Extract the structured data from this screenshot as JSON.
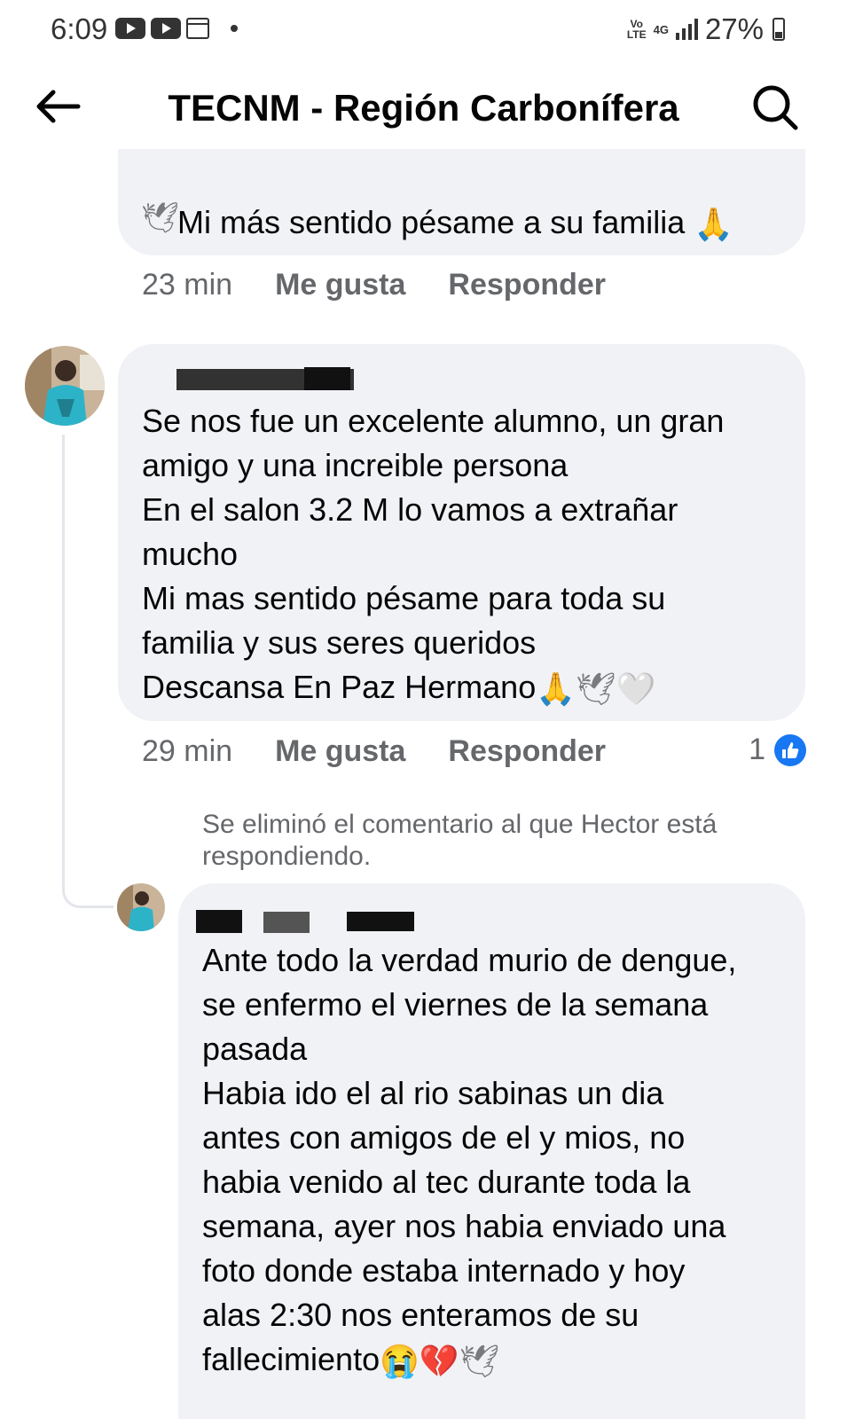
{
  "status_bar": {
    "time": "6:09",
    "network": "4G",
    "lte": "Vo LTE",
    "battery": "27%"
  },
  "header": {
    "title": "TECNM - Región Carbonífera"
  },
  "comment_top": {
    "text": "Mi más sentido pésame a su familia ",
    "time": "23 min",
    "like_label": "Me gusta",
    "reply_label": "Responder"
  },
  "comment_main": {
    "text": "Se nos fue un excelente alumno, un gran\namigo y una increible persona\nEn el salon 3.2 M lo vamos a extrañar\nmucho\nMi mas sentido pésame para toda su\nfamilia y sus seres queridos\nDescansa En Paz Hermano",
    "time": "29 min",
    "like_label": "Me gusta",
    "reply_label": "Responder",
    "likes": "1"
  },
  "deleted_notice": "Se eliminó el comentario al que Hector está respondiendo.",
  "reply": {
    "text": "Ante todo la verdad murio de dengue,\nse enfermo el viernes de la semana\npasada\nHabia ido el al rio sabinas un dia\nantes con amigos de el y mios, no\nhabia venido al tec durante toda la\nsemana, ayer nos habia enviado una\nfoto donde estaba internado y hoy\nalas 2:30 nos enteramos de su\nfallecimiento"
  },
  "colors": {
    "bubble": "#f0f2f5",
    "meta": "#65676b",
    "like_blue": "#1877f2"
  }
}
